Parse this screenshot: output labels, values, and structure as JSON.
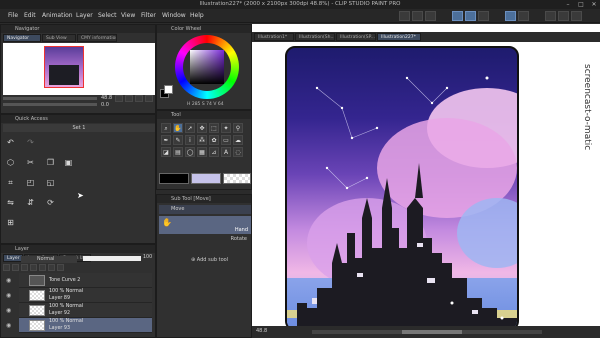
{
  "window": {
    "title": "Illustration227* (2000 x 2100px 300dpi 48.8%) - CLIP STUDIO PAINT PRO",
    "controls": [
      "–",
      "□",
      "✕"
    ]
  },
  "menu": [
    "File",
    "Edit",
    "Animation",
    "Layer",
    "Select",
    "View",
    "Filter",
    "Window",
    "Help"
  ],
  "navigator": {
    "title": "Navigator",
    "tabs": [
      "Navigator",
      "Sub View",
      "CMY information"
    ],
    "zoom": "48.8",
    "angle": "0.0"
  },
  "color_wheel": {
    "title": "Color Wheel",
    "h": "285",
    "s": "74",
    "v": "64"
  },
  "quick_access": {
    "title": "Quick Access",
    "set": "Set 1"
  },
  "tool_panel": {
    "title": "Tool"
  },
  "sub_tool": {
    "title": "Sub Tool [Move]",
    "tool_name": "Move",
    "item": "Hand",
    "rotate_label": "Rotate",
    "add_label": "Add sub tool"
  },
  "layers": {
    "title": "Layer",
    "tabs": [
      "Layer",
      "Layer Property",
      "Search layer"
    ],
    "blend_mode": "Normal",
    "opacity": "100",
    "rows": [
      {
        "name": "Tone Curve 2",
        "mode": ""
      },
      {
        "name": "Layer 89",
        "mode": "100 % Normal"
      },
      {
        "name": "Layer 92",
        "mode": "100 % Normal"
      },
      {
        "name": "Layer 93",
        "mode": "100 % Normal"
      }
    ]
  },
  "canvas": {
    "tabs": [
      "Illustration1*",
      "Illustration(Sh...",
      "Illustration(SP...",
      "Illustration227*"
    ],
    "status_zoom": "48.8",
    "watermark": "screencast-o-matic"
  },
  "colors": {
    "accent": "#4c6f9a",
    "layer_selected": "#5a6682",
    "canvas_bg": "#ffffff"
  }
}
